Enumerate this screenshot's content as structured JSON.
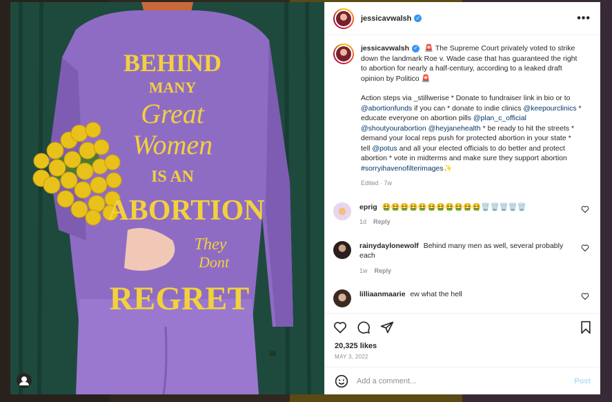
{
  "post": {
    "username": "jessicavwalsh",
    "verified": true,
    "caption": {
      "line1": "🚨 The Supreme Court privately voted to strike down the landmark Roe v. Wade case that has guaranteed the right to abortion for nearly a half-century, according to a leaked draft opinion by Politico 🚨",
      "line2_a": "Action steps via _stillwerise * Donate to fundraiser link in bio or to ",
      "mention1": "@abortionfunds",
      "line2_b": " if you can * donate to indie clinics ",
      "mention2": "@keepourclinics",
      "line2_c": " * educate everyone on abortion pills ",
      "mention3": "@plan_c_official",
      "mention4": "@shoutyourabortion",
      "mention5": "@heyjanehealth",
      "line2_d": " * be ready to hit the streets * demand your local reps push for protected abortion in your state * tell ",
      "mention6": "@potus",
      "line2_e": " and all your elected officials to do better and protect abortion * vote in midterms and make sure they support abortion ",
      "hashtag": "#sorryihavenofilterimages",
      "sparkle": "✨",
      "edited": "Edited",
      "time": "7w"
    },
    "image_text": {
      "behind": "BEHIND",
      "many": "MANY",
      "great": "Great",
      "women": "Women",
      "is_an": "IS AN",
      "abortion": "ABORTION",
      "they": "They",
      "dont": "Dont",
      "regret": "REGRET"
    },
    "comments": [
      {
        "username": "eprig",
        "text": "🤮🤮🤮🤮🤮🤮🤮🤮🤮🤮🤮🗑️🗑️🗑️🗑️🗑️",
        "time": "1d",
        "reply": "Reply"
      },
      {
        "username": "rainydaylonewolf",
        "text": "Behind many men as well, several probably each",
        "time": "1w",
        "reply": "Reply"
      },
      {
        "username": "lilliaanmaarie",
        "text": "ew what the hell"
      }
    ],
    "likes": "20,325 likes",
    "date": "MAY 3, 2022",
    "add_comment_placeholder": "Add a comment...",
    "post_label": "Post"
  },
  "colors": {
    "accent": "#3897f0",
    "shirt": "#8f6cc4",
    "lettering": "#f2d13c",
    "curtain": "#1f4a3f",
    "link": "#00376b",
    "post_button": "#b2dffc"
  }
}
